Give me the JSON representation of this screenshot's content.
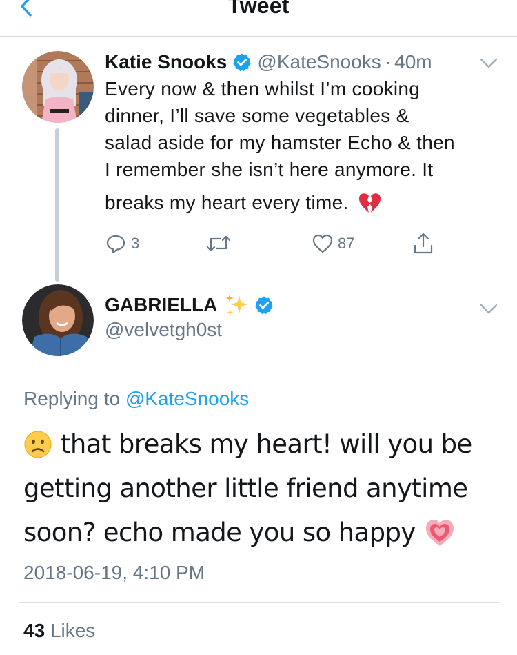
{
  "header": {
    "title": "Tweet",
    "back_icon": "chevron-left-icon"
  },
  "colors": {
    "accent": "#1da1f2",
    "text_primary": "#14171a",
    "text_secondary": "#657786",
    "divider": "#d6dde3",
    "thread_line": "#c4cfd6"
  },
  "parent_tweet": {
    "author_name": "Katie Snooks",
    "verified": true,
    "handle": "@KateSnooks",
    "separator": "·",
    "time_ago": "40m",
    "text_lines": [
      "Every now & then whilst I’m cooking",
      "dinner, I’ll save some vegetables &",
      "salad aside for my hamster Echo & then",
      "I remember she isn’t here anymore. It",
      "breaks my heart every time."
    ],
    "trailing_emoji": "broken-heart-icon",
    "actions": {
      "reply_count": "3",
      "retweet_count": "",
      "like_count": "87"
    }
  },
  "reply_tweet": {
    "author_name": "GABRIELLA",
    "name_emoji": "sparkles-icon",
    "verified": true,
    "handle": "@velvetgh0st",
    "replying_prefix": "Replying to",
    "replying_to": "@KateSnooks",
    "text_lines": [
      "that breaks my heart! will you be",
      "getting another little friend anytime",
      "soon? echo made you so happy"
    ],
    "leading_emoji": "frowning-face-icon",
    "trailing_emoji": "growing-heart-icon",
    "timestamp": "2018-06-19, 4:10 PM",
    "likes_count": "43",
    "likes_label": "Likes"
  }
}
